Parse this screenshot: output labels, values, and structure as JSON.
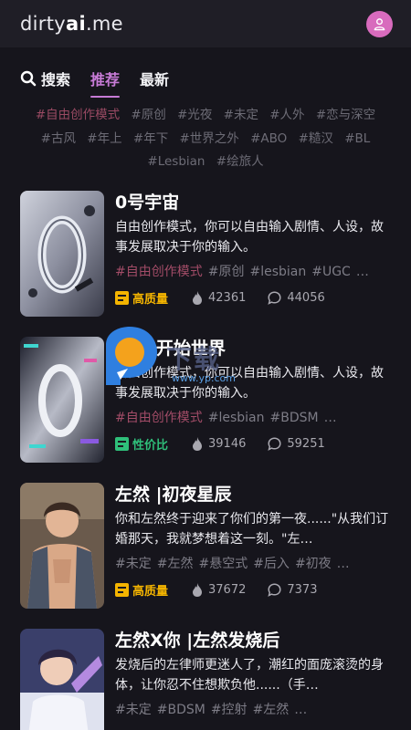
{
  "header": {
    "logo_pre": "dirty",
    "logo_bold": "ai",
    "logo_post": ".me"
  },
  "tabs": [
    {
      "label": "搜索",
      "active": false
    },
    {
      "label": "推荐",
      "active": true
    },
    {
      "label": "最新",
      "active": false
    }
  ],
  "tag_filters": [
    "#自由创作模式",
    "#原创",
    "#光夜",
    "#未定",
    "#人外",
    "#恋与深空",
    "#古风",
    "#年上",
    "#年下",
    "#世界之外",
    "#ABO",
    "#糙汉",
    "#BL",
    "#Lesbian",
    "#绘旅人"
  ],
  "cards": [
    {
      "title": "0号宇宙",
      "desc": "自由创作模式，你可以自由输入剧情、人设，故事发展取决于你的输入。",
      "tags": [
        "#自由创作模式",
        "#原创",
        "#lesbian",
        "#UGC",
        "…"
      ],
      "badge": "高质量",
      "badge_color": "#f4b400",
      "heat": "42361",
      "comments": "44056"
    },
    {
      "title": "UGC开始世界",
      "desc": "自由创作模式，你可以自由输入剧情、人设，故事发展取决于你的输入。",
      "tags": [
        "#自由创作模式",
        "#lesbian",
        "#BDSM",
        "…"
      ],
      "badge": "性价比",
      "badge_color": "#2fbf7a",
      "heat": "39146",
      "comments": "59251"
    },
    {
      "title": "左然 |初夜星辰",
      "desc": "你和左然终于迎来了你们的第一夜......\"从我们订婚那天，我就梦想着这一刻。\"左…",
      "tags": [
        "#未定",
        "#左然",
        "#悬空式",
        "#后入",
        "#初夜",
        "…"
      ],
      "badge": "高质量",
      "badge_color": "#f4b400",
      "heat": "37672",
      "comments": "7373"
    },
    {
      "title": "左然X你 |左然发烧后",
      "desc": "发烧后的左律师更迷人了，潮红的面庞滚烫的身体，让你忍不住想欺负他......（手…",
      "tags": [
        "#未定",
        "#BDSM",
        "#控射",
        "#左然",
        "…"
      ],
      "badge": "",
      "badge_color": "#f4b400",
      "heat": "",
      "comments": ""
    }
  ],
  "watermark": {
    "text": "下载",
    "url": "www.yp.com"
  }
}
